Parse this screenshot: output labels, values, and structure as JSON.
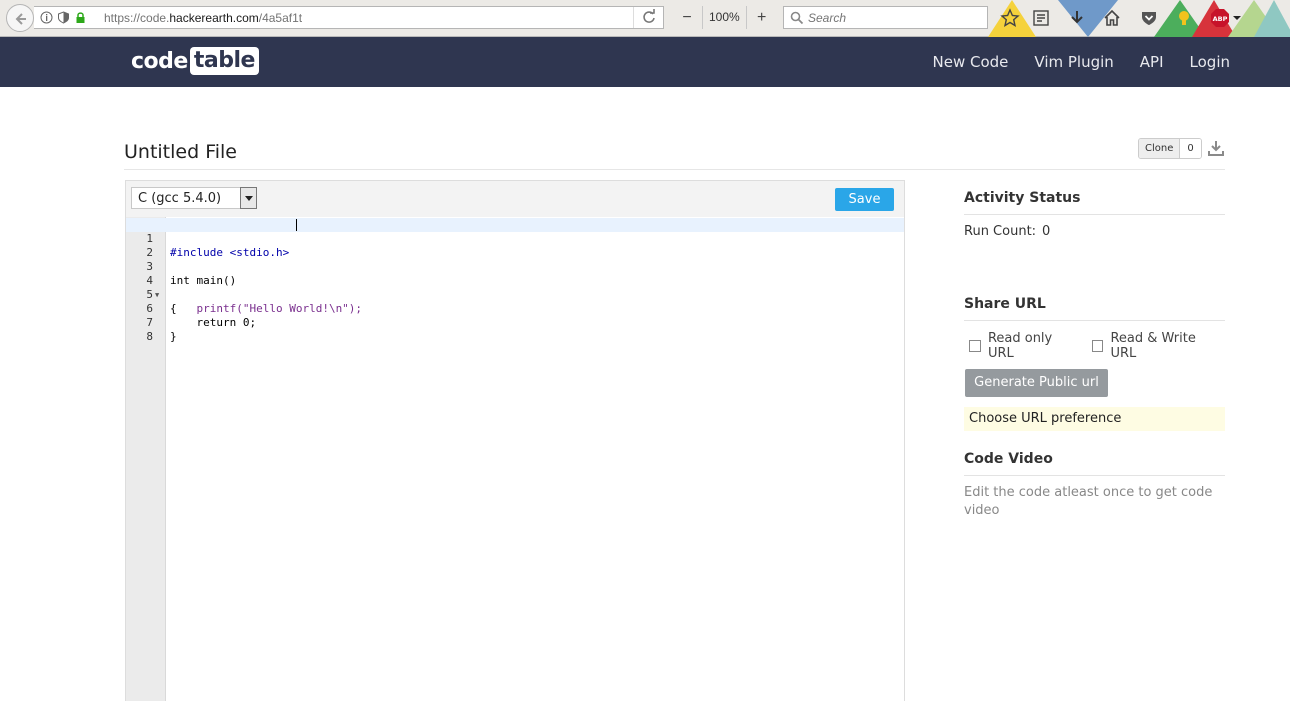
{
  "browser": {
    "url_prefix": "https://code.",
    "url_domain": "hackerearth.com",
    "url_path": "/4a5af1t",
    "zoom": "100%",
    "zoom_out": "−",
    "zoom_in": "+",
    "search_placeholder": "Search",
    "abp_label": "ABP"
  },
  "header": {
    "logo_part1": "code",
    "logo_part2": "table",
    "nav": [
      "New Code",
      "Vim Plugin",
      "API",
      "Login"
    ]
  },
  "file": {
    "title": "Untitled File",
    "clone_label": "Clone",
    "clone_count": "0"
  },
  "editor": {
    "language": "C (gcc 5.4.0)",
    "save_label": "Save",
    "lines": [
      {
        "n": "1",
        "text": "#include <stdio.h>"
      },
      {
        "n": "2",
        "text": ""
      },
      {
        "n": "3",
        "text": "int main()"
      },
      {
        "n": "4",
        "text": "{"
      },
      {
        "n": "5",
        "text": "    printf(\"Hello World!\\n\");"
      },
      {
        "n": "6",
        "text": "    return 0;"
      },
      {
        "n": "7",
        "text": "}"
      },
      {
        "n": "8",
        "text": ""
      }
    ]
  },
  "sidebar": {
    "activity_title": "Activity Status",
    "run_count_label": "Run Count:",
    "run_count_value": "0",
    "share_title": "Share URL",
    "read_only_label": "Read only URL",
    "read_write_label": "Read & Write URL",
    "generate_label": "Generate Public url",
    "preference_text": "Choose URL preference",
    "video_title": "Code Video",
    "video_text": "Edit the code atleast once to get code video"
  },
  "colors": {
    "header_bg": "#2f3650",
    "save_button": "#2aa6e8",
    "generate_button": "#959a9e",
    "preference_bg": "#fefce3"
  }
}
